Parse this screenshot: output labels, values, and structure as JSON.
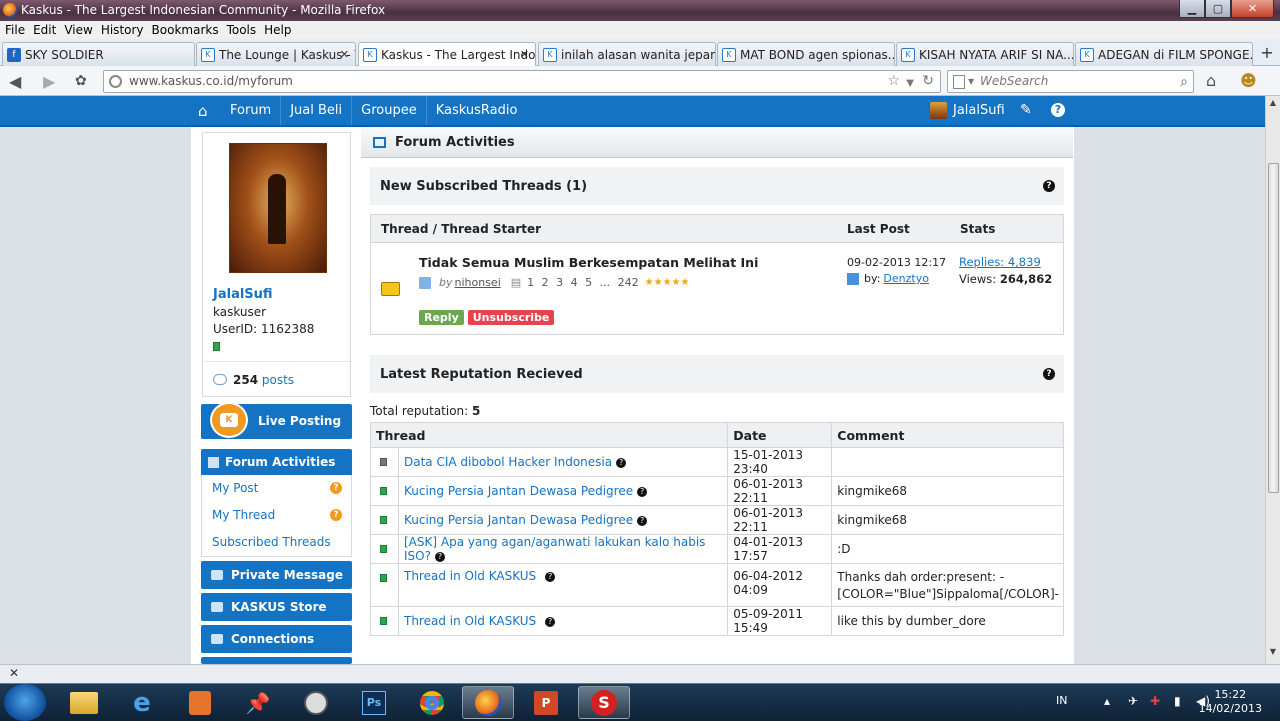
{
  "window": {
    "title": "Kaskus - The Largest Indonesian Community - Mozilla Firefox"
  },
  "menu": [
    "File",
    "Edit",
    "View",
    "History",
    "Bookmarks",
    "Tools",
    "Help"
  ],
  "tabs": [
    {
      "label": "SKY SOLDIER",
      "icon": "facebook-icon"
    },
    {
      "label": "The Lounge | Kaskus - The...",
      "icon": "kaskus-icon"
    },
    {
      "label": "Kaskus - The Largest Indo...",
      "icon": "kaskus-icon",
      "active": true
    },
    {
      "label": "inilah alasan wanita jepan...",
      "icon": "kaskus-icon"
    },
    {
      "label": "MAT BOND agen spionas...",
      "icon": "kaskus-icon"
    },
    {
      "label": "KISAH NYATA ARIF SI NA...",
      "icon": "kaskus-icon"
    },
    {
      "label": "ADEGAN di FILM SPONGE...",
      "icon": "kaskus-icon"
    }
  ],
  "nav": {
    "url": "www.kaskus.co.id/myforum",
    "search_placeholder": "WebSearch"
  },
  "sitenav": {
    "links": [
      "Forum",
      "Jual Beli",
      "Groupee",
      "KaskusRadio"
    ],
    "username": "JalalSufi"
  },
  "profile": {
    "name": "JalalSufi",
    "rank": "kaskuser",
    "userid": "UserID: 1162388",
    "posts_count": "254",
    "posts_label": "posts"
  },
  "sidebar": {
    "live_posting": "Live Posting",
    "forum_activities": "Forum Activities",
    "sub_items": [
      "My Post",
      "My Thread",
      "Subscribed Threads"
    ],
    "private_message": "Private Message",
    "kaskus_store": "KASKUS Store",
    "connections": "Connections"
  },
  "main": {
    "title": "Forum Activities",
    "subscribed": {
      "heading": "New Subscribed Threads (1)",
      "col_thread": "Thread / Thread Starter",
      "col_lastpost": "Last Post",
      "col_stats": "Stats",
      "thread_title": "Tidak Semua Muslim Berkesempatan Melihat Ini",
      "by_label": "by",
      "starter": "nihonsei",
      "pages": "1  2  3  4  5 ... 242",
      "stars": "★★★★★",
      "reply": "Reply",
      "unsubscribe": "Unsubscribe",
      "lastpost_date": "09-02-2013 12:17",
      "lastpost_by_label": "by:",
      "lastpost_user": "Denztyo",
      "replies": "Replies: 4,839",
      "views_label": "Views:",
      "views": "264,862"
    },
    "reputation": {
      "heading": "Latest Reputation Recieved",
      "total_label": "Total reputation:",
      "total": "5",
      "columns": [
        "Thread",
        "Date",
        "Comment"
      ],
      "rows": [
        {
          "thread": "Data CIA dibobol Hacker Indonesia",
          "date": "15-01-2013 23:40",
          "comment": "",
          "grey": true
        },
        {
          "thread": "Kucing Persia Jantan Dewasa Pedigree",
          "date": "06-01-2013 22:11",
          "comment": "kingmike68"
        },
        {
          "thread": "Kucing Persia Jantan Dewasa Pedigree",
          "date": "06-01-2013 22:11",
          "comment": "kingmike68"
        },
        {
          "thread": "[ASK] Apa yang agan/aganwati lakukan kalo habis ISO?",
          "date": "04-01-2013 17:57",
          "comment": ":D"
        },
        {
          "thread": "Thread in Old KASKUS",
          "date": "06-04-2012 04:09",
          "comment": "Thanks dah order:present: -[COLOR=\"Blue\"]Sippaloma[/COLOR]-"
        },
        {
          "thread": "Thread in Old KASKUS",
          "date": "05-09-2011 15:49",
          "comment": "like this by dumber_dore"
        }
      ]
    }
  },
  "taskbar": {
    "lang": "IN",
    "time": "15:22",
    "date": "14/02/2013"
  },
  "colors": {
    "brand": "#1573c4",
    "green": "#2ea44f",
    "orange": "#f29a1f",
    "red": "#e8424a"
  }
}
